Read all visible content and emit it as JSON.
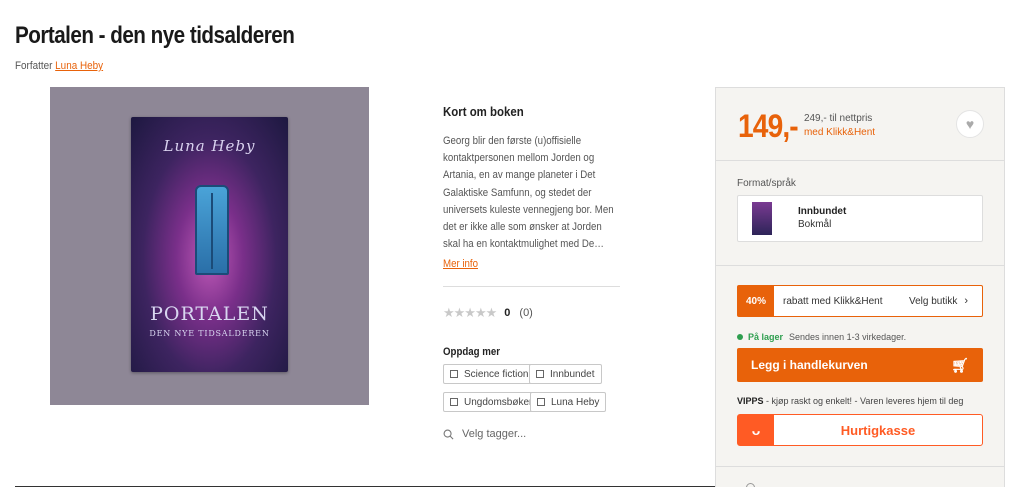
{
  "product": {
    "title": "Portalen - den nye tidsalderen",
    "author_label": "Forfatter",
    "author_name": "Luna Heby"
  },
  "cover": {
    "author_text": "Luna Heby",
    "title_text": "PORTALEN",
    "subtitle_text": "DEN NYE TIDSALDEREN"
  },
  "about": {
    "heading": "Kort om boken",
    "text": "Georg blir den første (u)offisielle kontaktpersonen mellom Jorden og Artania, en av mange planeter i Det Galaktiske Samfunn, og stedet der universets kuleste vennegjeng bor. Men det er ikke alle som ønsker at Jorden skal ha en kontaktmulighet med De…",
    "more_link": "Mer info"
  },
  "rating": {
    "stars": "★★★★★",
    "value": "0",
    "count": "(0)"
  },
  "discover": {
    "heading": "Oppdag mer",
    "tags": [
      "Science fiction",
      "Innbundet",
      "Ungdomsbøker",
      "Luna Heby"
    ],
    "search_placeholder": "Velg tagger..."
  },
  "buy_panel": {
    "price": "149,-",
    "list_price": "249,- til nettpris",
    "price_note": "med Klikk&Hent",
    "format_label": "Format/språk",
    "format_name": "Innbundet",
    "format_language": "Bokmål",
    "promo_percent": "40%",
    "promo_text": "rabatt med Klikk&Hent",
    "promo_action": "Velg butikk",
    "stock_status": "På lager",
    "stock_text": "Sendes innen 1-3 virkedager.",
    "cart_button": "Legg i handlekurven",
    "vipps_brand": "VIPPS",
    "vipps_text": " - kjøp raskt og enkelt! - Varen leveres hjem til deg",
    "vipps_button": "Hurtigkasse"
  },
  "colors": {
    "accent": "#e8620a",
    "vipps": "#ff5b24",
    "in_stock": "#2e9e4f"
  },
  "icons": {
    "wishlist": "heart-icon",
    "cart": "shopping-cart-icon",
    "search": "search-icon",
    "chevron": "chevron-right-icon"
  }
}
